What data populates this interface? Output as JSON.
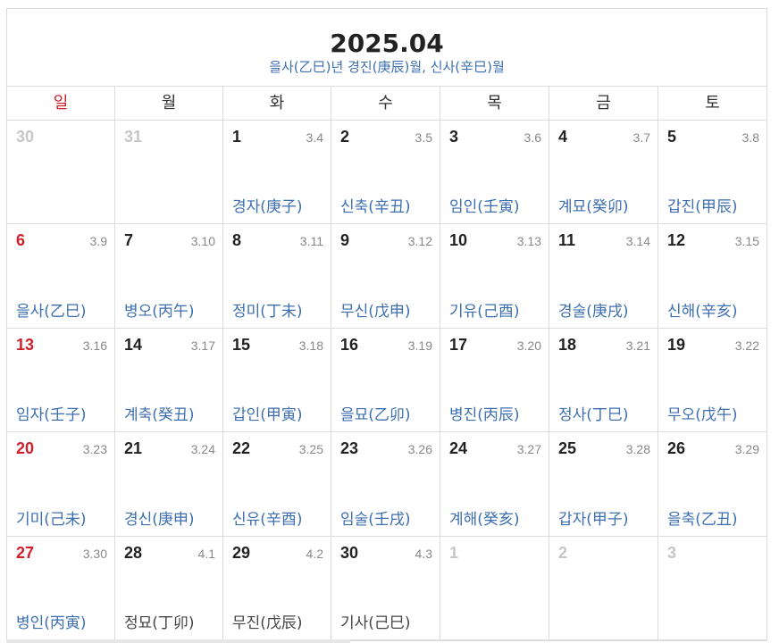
{
  "calendar": {
    "title": "2025.04",
    "subtitle": "을사(乙巳)년 경진(庚辰)월, 신사(辛巳)월",
    "weekdays": [
      "일",
      "월",
      "화",
      "수",
      "목",
      "금",
      "토"
    ],
    "weeks": [
      [
        {
          "day": "30",
          "lunar": "",
          "ganji": "",
          "other": true
        },
        {
          "day": "31",
          "lunar": "",
          "ganji": "",
          "other": true
        },
        {
          "day": "1",
          "lunar": "3.4",
          "ganji": "경자(庚子)"
        },
        {
          "day": "2",
          "lunar": "3.5",
          "ganji": "신축(辛丑)"
        },
        {
          "day": "3",
          "lunar": "3.6",
          "ganji": "임인(壬寅)"
        },
        {
          "day": "4",
          "lunar": "3.7",
          "ganji": "계묘(癸卯)"
        },
        {
          "day": "5",
          "lunar": "3.8",
          "ganji": "갑진(甲辰)"
        }
      ],
      [
        {
          "day": "6",
          "lunar": "3.9",
          "ganji": "을사(乙巳)"
        },
        {
          "day": "7",
          "lunar": "3.10",
          "ganji": "병오(丙午)"
        },
        {
          "day": "8",
          "lunar": "3.11",
          "ganji": "정미(丁未)"
        },
        {
          "day": "9",
          "lunar": "3.12",
          "ganji": "무신(戊申)"
        },
        {
          "day": "10",
          "lunar": "3.13",
          "ganji": "기유(己酉)"
        },
        {
          "day": "11",
          "lunar": "3.14",
          "ganji": "경술(庚戌)"
        },
        {
          "day": "12",
          "lunar": "3.15",
          "ganji": "신해(辛亥)"
        }
      ],
      [
        {
          "day": "13",
          "lunar": "3.16",
          "ganji": "임자(壬子)"
        },
        {
          "day": "14",
          "lunar": "3.17",
          "ganji": "계축(癸丑)"
        },
        {
          "day": "15",
          "lunar": "3.18",
          "ganji": "갑인(甲寅)"
        },
        {
          "day": "16",
          "lunar": "3.19",
          "ganji": "을묘(乙卯)"
        },
        {
          "day": "17",
          "lunar": "3.20",
          "ganji": "병진(丙辰)"
        },
        {
          "day": "18",
          "lunar": "3.21",
          "ganji": "정사(丁巳)"
        },
        {
          "day": "19",
          "lunar": "3.22",
          "ganji": "무오(戊午)"
        }
      ],
      [
        {
          "day": "20",
          "lunar": "3.23",
          "ganji": "기미(己未)"
        },
        {
          "day": "21",
          "lunar": "3.24",
          "ganji": "경신(庚申)"
        },
        {
          "day": "22",
          "lunar": "3.25",
          "ganji": "신유(辛酉)"
        },
        {
          "day": "23",
          "lunar": "3.26",
          "ganji": "임술(壬戌)"
        },
        {
          "day": "24",
          "lunar": "3.27",
          "ganji": "계해(癸亥)"
        },
        {
          "day": "25",
          "lunar": "3.28",
          "ganji": "갑자(甲子)"
        },
        {
          "day": "26",
          "lunar": "3.29",
          "ganji": "을축(乙丑)"
        }
      ],
      [
        {
          "day": "27",
          "lunar": "3.30",
          "ganji": "병인(丙寅)"
        },
        {
          "day": "28",
          "lunar": "4.1",
          "ganji": "정묘(丁卯)",
          "dark": true
        },
        {
          "day": "29",
          "lunar": "4.2",
          "ganji": "무진(戊辰)",
          "dark": true
        },
        {
          "day": "30",
          "lunar": "4.3",
          "ganji": "기사(己巳)",
          "dark": true
        },
        {
          "day": "1",
          "lunar": "",
          "ganji": "",
          "other": true
        },
        {
          "day": "2",
          "lunar": "",
          "ganji": "",
          "other": true
        },
        {
          "day": "3",
          "lunar": "",
          "ganji": "",
          "other": true
        }
      ]
    ]
  },
  "colors": {
    "sunday": "#d0202a",
    "ganji": "#3d6fb0",
    "other_month": "#c6c6c6",
    "border": "#dcdcdc"
  }
}
